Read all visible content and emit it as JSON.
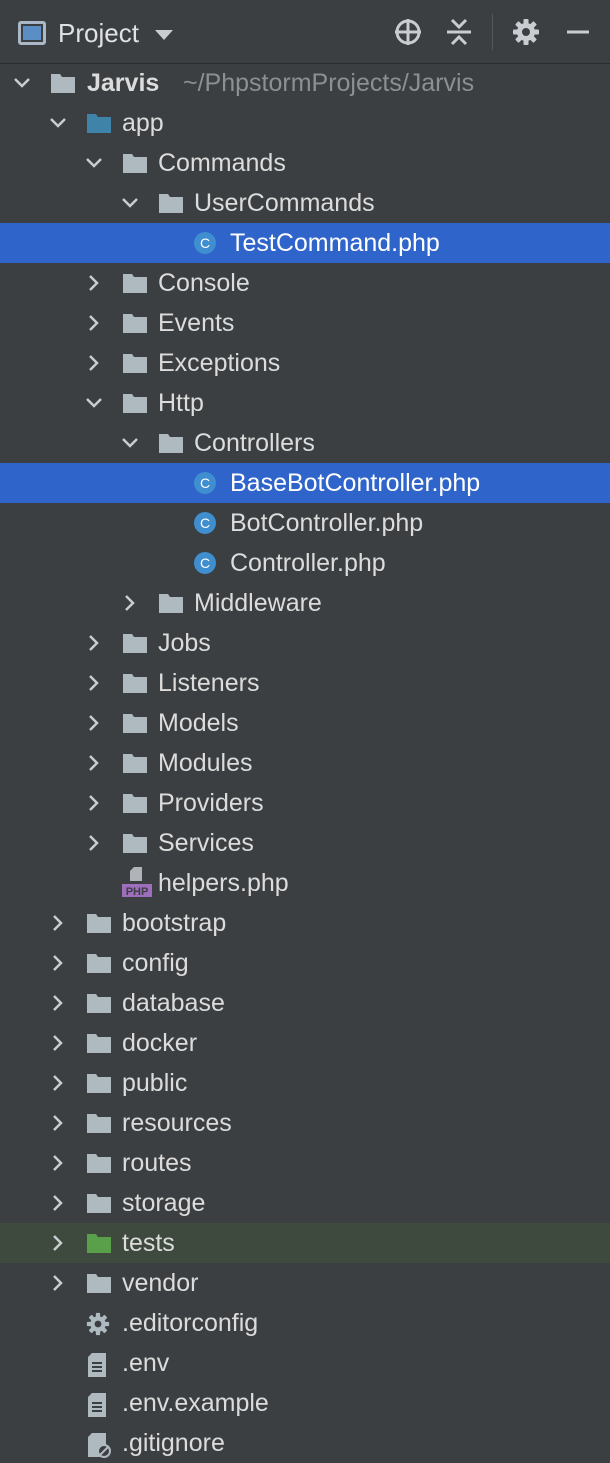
{
  "header": {
    "title": "Project",
    "tools": [
      "crosshair-icon",
      "collapse-all-icon",
      "gear-icon",
      "minimize-icon"
    ]
  },
  "colors": {
    "background": "#3c3f41",
    "selection": "#2f65ca",
    "folder": "#aeb9c0",
    "module_folder": "#3f84a8",
    "test_folder": "#5a9f4a",
    "test_row": "#3d4a3d",
    "class_badge": "#3e8ed0",
    "php_badge": "#9e6dbc"
  },
  "project": {
    "name": "Jarvis",
    "path": "~/PhpstormProjects/Jarvis"
  },
  "tree": [
    {
      "label": "app",
      "level": 1,
      "type": "module-folder",
      "expanded": true
    },
    {
      "label": "Commands",
      "level": 2,
      "type": "folder",
      "expanded": true
    },
    {
      "label": "UserCommands",
      "level": 3,
      "type": "folder",
      "expanded": true
    },
    {
      "label": "TestCommand.php",
      "level": 4,
      "type": "class-file",
      "selected": true
    },
    {
      "label": "Console",
      "level": 2,
      "type": "folder",
      "expanded": false
    },
    {
      "label": "Events",
      "level": 2,
      "type": "folder",
      "expanded": false
    },
    {
      "label": "Exceptions",
      "level": 2,
      "type": "folder",
      "expanded": false
    },
    {
      "label": "Http",
      "level": 2,
      "type": "folder",
      "expanded": true
    },
    {
      "label": "Controllers",
      "level": 3,
      "type": "folder",
      "expanded": true
    },
    {
      "label": "BaseBotController.php",
      "level": 4,
      "type": "class-file",
      "selected": true
    },
    {
      "label": "BotController.php",
      "level": 4,
      "type": "class-file"
    },
    {
      "label": "Controller.php",
      "level": 4,
      "type": "class-file"
    },
    {
      "label": "Middleware",
      "level": 3,
      "type": "folder",
      "expanded": false
    },
    {
      "label": "Jobs",
      "level": 2,
      "type": "folder",
      "expanded": false
    },
    {
      "label": "Listeners",
      "level": 2,
      "type": "folder",
      "expanded": false
    },
    {
      "label": "Models",
      "level": 2,
      "type": "folder",
      "expanded": false
    },
    {
      "label": "Modules",
      "level": 2,
      "type": "folder",
      "expanded": false
    },
    {
      "label": "Providers",
      "level": 2,
      "type": "folder",
      "expanded": false
    },
    {
      "label": "Services",
      "level": 2,
      "type": "folder",
      "expanded": false
    },
    {
      "label": "helpers.php",
      "level": 2,
      "type": "php-file"
    },
    {
      "label": "bootstrap",
      "level": 1,
      "type": "folder",
      "expanded": false
    },
    {
      "label": "config",
      "level": 1,
      "type": "folder",
      "expanded": false
    },
    {
      "label": "database",
      "level": 1,
      "type": "folder",
      "expanded": false
    },
    {
      "label": "docker",
      "level": 1,
      "type": "folder",
      "expanded": false
    },
    {
      "label": "public",
      "level": 1,
      "type": "folder",
      "expanded": false
    },
    {
      "label": "resources",
      "level": 1,
      "type": "folder",
      "expanded": false
    },
    {
      "label": "routes",
      "level": 1,
      "type": "folder",
      "expanded": false
    },
    {
      "label": "storage",
      "level": 1,
      "type": "folder",
      "expanded": false
    },
    {
      "label": "tests",
      "level": 1,
      "type": "test-folder",
      "expanded": false,
      "tinted": true
    },
    {
      "label": "vendor",
      "level": 1,
      "type": "folder",
      "expanded": false
    },
    {
      "label": ".editorconfig",
      "level": 1,
      "type": "config-file"
    },
    {
      "label": ".env",
      "level": 1,
      "type": "text-file"
    },
    {
      "label": ".env.example",
      "level": 1,
      "type": "text-file"
    },
    {
      "label": ".gitignore",
      "level": 1,
      "type": "ignored-file"
    }
  ]
}
